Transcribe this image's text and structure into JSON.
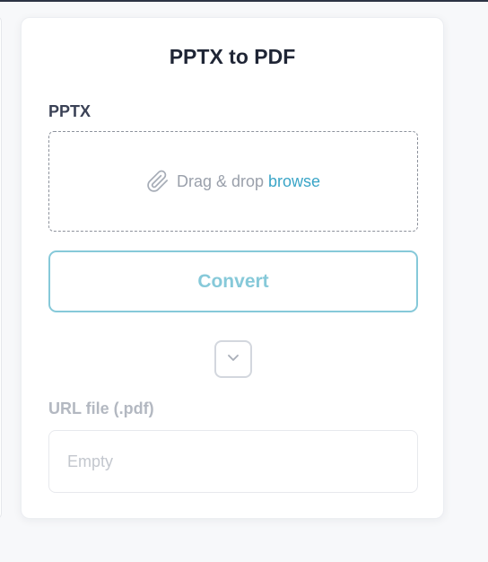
{
  "card": {
    "title": "PPTX to PDF",
    "input_label": "PPTX",
    "dropzone": {
      "icon": "paperclip-icon",
      "text": "Drag & drop",
      "browse_link": "browse"
    },
    "convert_label": "Convert",
    "expand_icon": "chevron-down-icon",
    "output_label": "URL file (.pdf)",
    "output_value": "Empty"
  },
  "colors": {
    "accent": "#3aa5c7",
    "button_outline": "#86c9d9",
    "title": "#1f2535"
  }
}
